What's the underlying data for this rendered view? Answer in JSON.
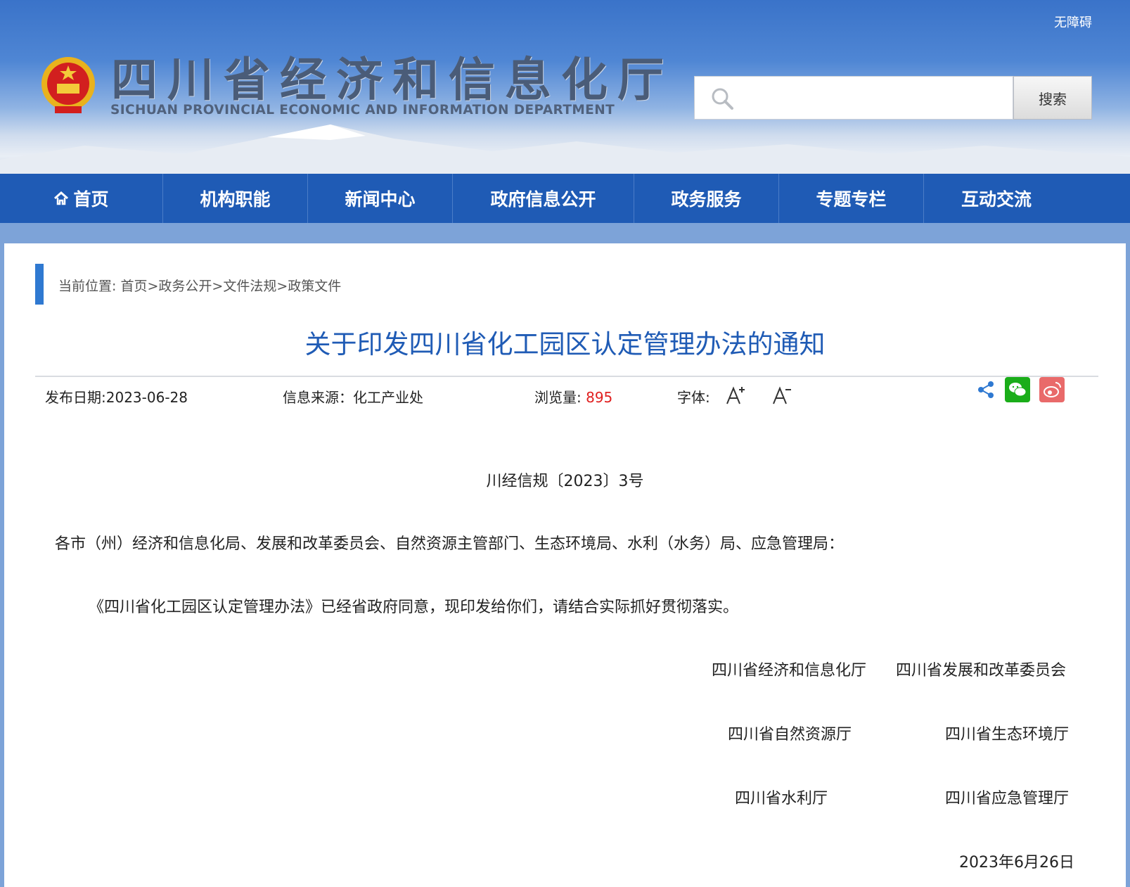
{
  "header": {
    "accessibility_label": "无障碍",
    "site_title": "四川省经济和信息化厅",
    "site_subtitle": "SICHUAN PROVINCIAL ECONOMIC AND INFORMATION DEPARTMENT",
    "search_placeholder": "",
    "search_button": "搜索"
  },
  "nav": {
    "items": [
      {
        "label": "首页",
        "icon": "home-icon"
      },
      {
        "label": "机构职能"
      },
      {
        "label": "新闻中心"
      },
      {
        "label": "政府信息公开"
      },
      {
        "label": "政务服务"
      },
      {
        "label": "专题专栏"
      },
      {
        "label": "互动交流"
      }
    ]
  },
  "breadcrumb": {
    "prefix": "当前位置:",
    "items": [
      "首页",
      "政务公开",
      "文件法规",
      "政策文件"
    ],
    "separator": ">"
  },
  "article": {
    "title": "关于印发四川省化工园区认定管理办法的通知",
    "publish_label": "发布日期:",
    "publish_date": "2023-06-28",
    "source_label": "信息来源：",
    "source": "化工产业处",
    "views_label": "浏览量:",
    "views": "895",
    "font_label": "字体:",
    "doc_number": "川经信规〔2023〕3号",
    "salutation": "各市（州）经济和信息化局、发展和改革委员会、自然资源主管部门、生态环境局、水利（水务）局、应急管理局：",
    "body": "《四川省化工园区认定管理办法》已经省政府同意，现印发给你们，请结合实际抓好贯彻落实。",
    "signatories": [
      "四川省经济和信息化厅",
      "四川省发展和改革委员会",
      "四川省自然资源厅",
      "四川省生态环境厅",
      "四川省水利厅",
      "四川省应急管理厅"
    ],
    "date": "2023年6月26日"
  },
  "colors": {
    "nav_bg": "#1f5bb5",
    "title_blue": "#1f5bb5",
    "views_red": "#e02020",
    "wechat_green": "#1aad19",
    "weibo_red": "#e96a6a"
  }
}
